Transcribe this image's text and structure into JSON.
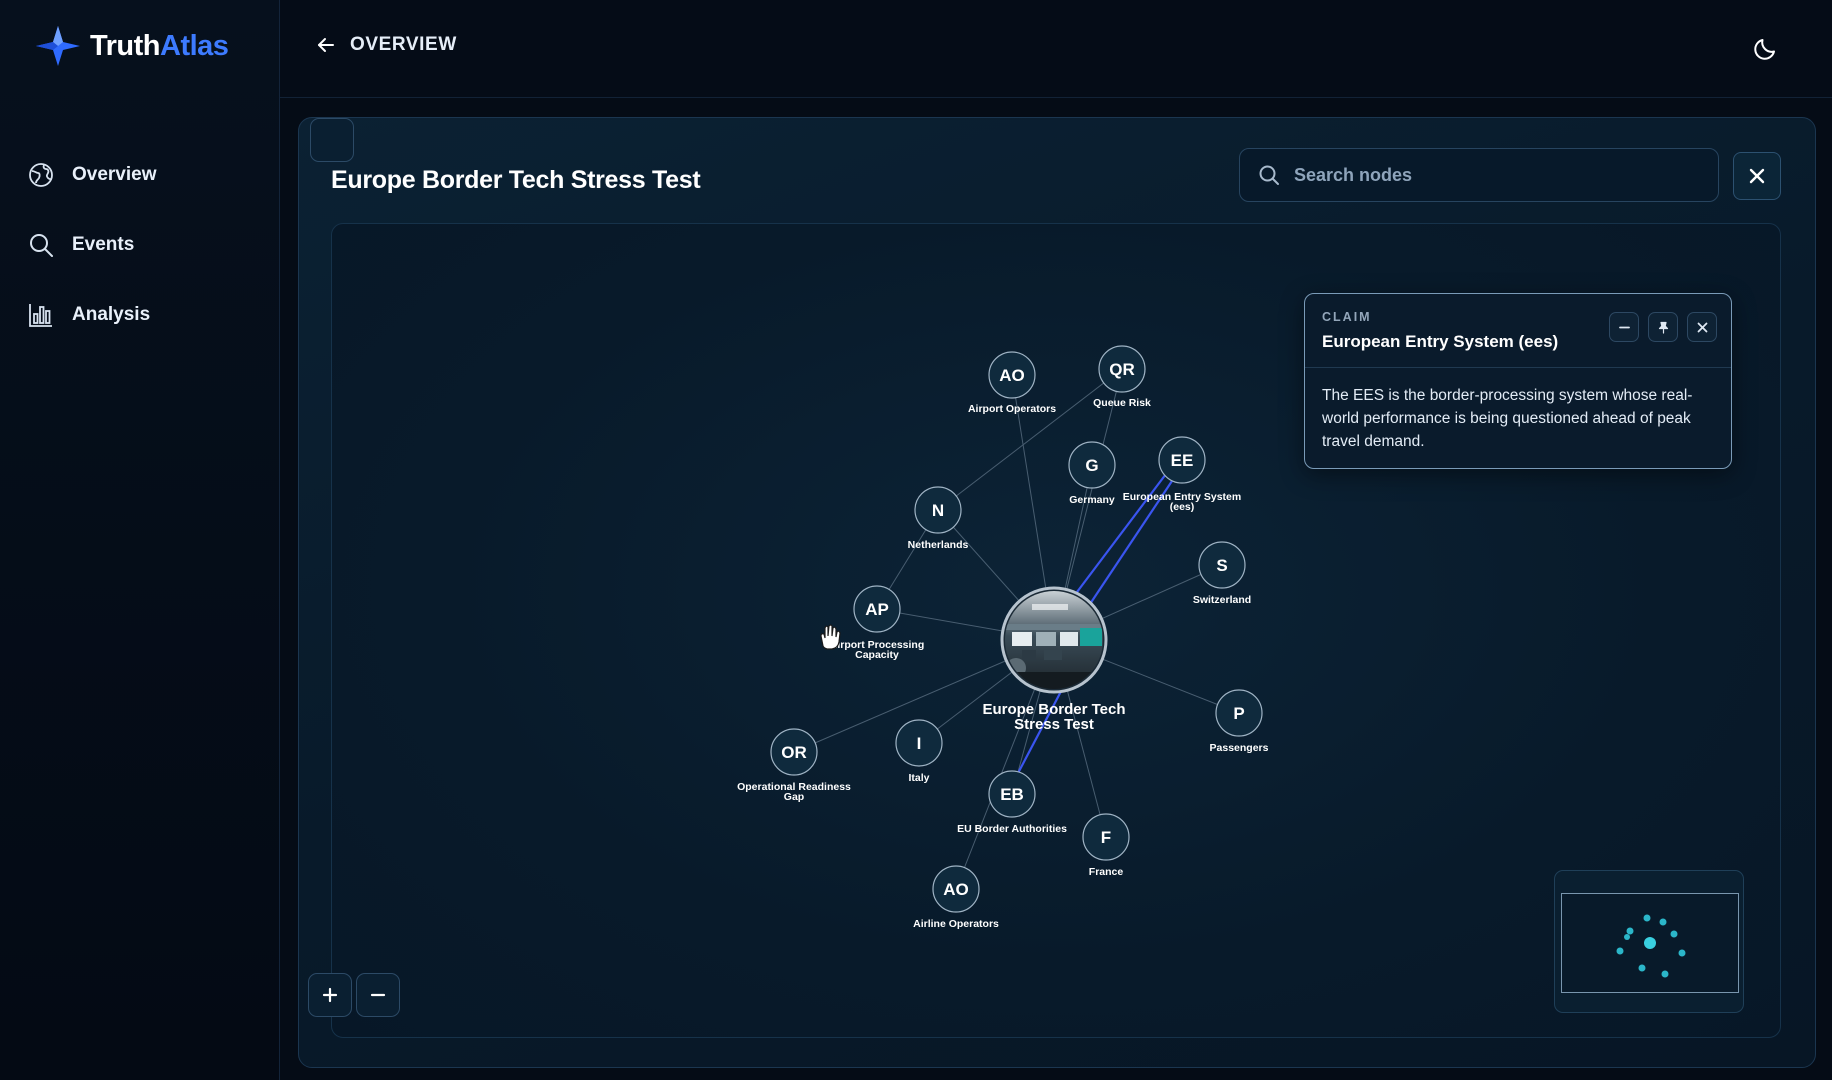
{
  "app": {
    "name_part1": "Truth",
    "name_part2": "Atlas"
  },
  "sidebar": {
    "items": [
      {
        "label": "Overview",
        "icon": "globe-icon"
      },
      {
        "label": "Events",
        "icon": "search-icon"
      },
      {
        "label": "Analysis",
        "icon": "bar-chart-icon"
      }
    ]
  },
  "header": {
    "back_label": "OVERVIEW",
    "theme_icon": "moon-icon"
  },
  "page": {
    "title": "Europe Border Tech Stress Test"
  },
  "search": {
    "placeholder": "Search nodes",
    "value": ""
  },
  "graph": {
    "center": {
      "label_line1": "Europe Border Tech",
      "label_line2": "Stress Test"
    },
    "nodes": [
      {
        "id": "ao1",
        "abbr": "AO",
        "label1": "Airport Operators",
        "label2": ""
      },
      {
        "id": "qr",
        "abbr": "QR",
        "label1": "Queue Risk",
        "label2": ""
      },
      {
        "id": "g",
        "abbr": "G",
        "label1": "Germany",
        "label2": ""
      },
      {
        "id": "ee",
        "abbr": "EE",
        "label1": "European Entry System",
        "label2": "(ees)"
      },
      {
        "id": "n",
        "abbr": "N",
        "label1": "Netherlands",
        "label2": ""
      },
      {
        "id": "s",
        "abbr": "S",
        "label1": "Switzerland",
        "label2": ""
      },
      {
        "id": "ap",
        "abbr": "AP",
        "label1": "Airport Processing",
        "label2": "Capacity"
      },
      {
        "id": "p",
        "abbr": "P",
        "label1": "Passengers",
        "label2": ""
      },
      {
        "id": "i",
        "abbr": "I",
        "label1": "Italy",
        "label2": ""
      },
      {
        "id": "or",
        "abbr": "OR",
        "label1": "Operational Readiness",
        "label2": "Gap"
      },
      {
        "id": "eb",
        "abbr": "EB",
        "label1": "EU Border Authorities",
        "label2": ""
      },
      {
        "id": "f",
        "abbr": "F",
        "label1": "France",
        "label2": ""
      },
      {
        "id": "ao2",
        "abbr": "AO",
        "label1": "Airline Operators",
        "label2": ""
      }
    ],
    "highlight_color": "#3a55f0",
    "edge_color": "#5d7285"
  },
  "claim": {
    "kicker": "CLAIM",
    "title": "European Entry System (ees)",
    "body": "The EES is the border-processing system whose real-world performance is being questioned ahead of peak travel demand."
  },
  "colors": {
    "brand": "#3d7bff",
    "background": "#050c16",
    "node_fill": "#0f2a3d"
  }
}
